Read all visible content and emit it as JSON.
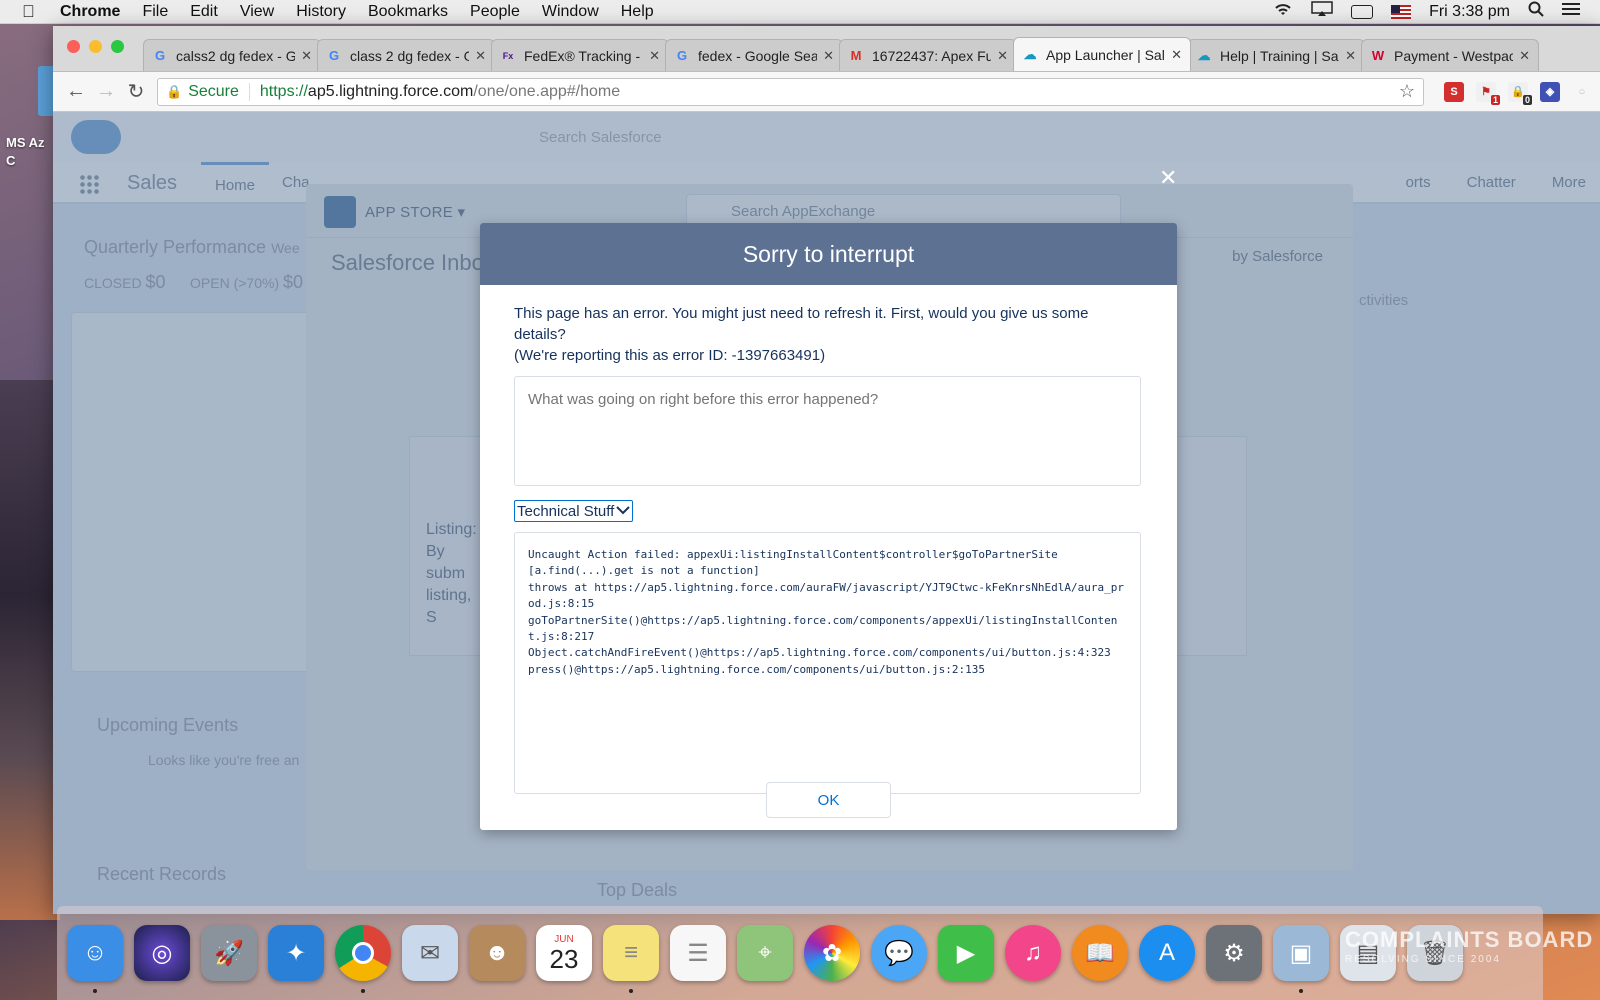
{
  "menubar": {
    "app": "Chrome",
    "items": [
      "File",
      "Edit",
      "View",
      "History",
      "Bookmarks",
      "People",
      "Window",
      "Help"
    ],
    "clock": "Fri 3:38 pm"
  },
  "desktop": {
    "label": "MS Az C"
  },
  "tabs": [
    {
      "title": "calss2 dg fedex - G",
      "icon": "google-icon",
      "active": false
    },
    {
      "title": "class 2 dg fedex - G",
      "icon": "google-icon",
      "active": false
    },
    {
      "title": "FedEx® Tracking - F",
      "icon": "fedex-icon",
      "active": false
    },
    {
      "title": "fedex - Google Sear",
      "icon": "google-icon",
      "active": false
    },
    {
      "title": "16722437: Apex Fu",
      "icon": "gmail-icon",
      "active": false
    },
    {
      "title": "App Launcher | Sal",
      "icon": "salesforce-icon",
      "active": true
    },
    {
      "title": "Help | Training | Sal",
      "icon": "salesforce-icon",
      "active": false
    },
    {
      "title": "Payment - Westpac",
      "icon": "westpac-icon",
      "active": false
    }
  ],
  "address": {
    "secure_label": "Secure",
    "scheme": "https://",
    "host": "ap5.lightning.force.com",
    "path": "/one/one.app#/home"
  },
  "extensions": {
    "badge_1": "1",
    "badge_2": "0"
  },
  "salesforce": {
    "search_placeholder": "Search Salesforce",
    "app_name": "Sales",
    "nav_home": "Home",
    "nav_cha": "Cha",
    "nav_right": [
      "orts",
      "Chatter",
      "More"
    ],
    "quarterly": "Quarterly Performance",
    "quarterly_sub": "Wee",
    "closed": "CLOSED",
    "closed_value": "$0",
    "open": "OPEN (>70%)",
    "open_value": "$0",
    "upcoming": "Upcoming Events",
    "upcoming_sub": "Looks like you're free an",
    "recent": "Recent Records",
    "top_deals": "Top Deals",
    "activities": "ctivities"
  },
  "appstore": {
    "title": "APP STORE",
    "search_placeholder": "Search AppExchange",
    "inbox": "Salesforce Inbo",
    "by": "by Salesforce",
    "listing": "Listing: By subm listing, S"
  },
  "dialog": {
    "title": "Sorry to interrupt",
    "message_line1": "This page has an error. You might just need to refresh it. First, would you give us some details?",
    "message_line2": "(We're reporting this as error ID: -1397663491)",
    "feedback_placeholder": "What was going on right before this error happened?",
    "technical_label": "Technical Stuff",
    "stack_trace": "Uncaught Action failed: appexUi:listingInstallContent$controller$goToPartnerSite\n[a.find(...).get is not a function]\nthrows at https://ap5.lightning.force.com/auraFW/javascript/YJT9Ctwc-kFeKnrsNhEdlA/aura_prod.js:8:15\ngoToPartnerSite()@https://ap5.lightning.force.com/components/appexUi/listingInstallContent.js:8:217\nObject.catchAndFireEvent()@https://ap5.lightning.force.com/components/ui/button.js:4:323\npress()@https://ap5.lightning.force.com/components/ui/button.js:2:135",
    "ok_label": "OK"
  },
  "dock": {
    "apps": [
      {
        "name": "finder",
        "color": "#3a8ee6",
        "running": true
      },
      {
        "name": "siri",
        "color": "#2b2f6b",
        "running": false
      },
      {
        "name": "launchpad",
        "color": "#8a929c",
        "running": false
      },
      {
        "name": "safari",
        "color": "#2a7fd6",
        "running": false
      },
      {
        "name": "chrome",
        "color": "#e8e8e8",
        "running": true
      },
      {
        "name": "mail",
        "color": "#c9d8ea",
        "running": false
      },
      {
        "name": "contacts",
        "color": "#b58a5c",
        "running": false
      },
      {
        "name": "calendar",
        "color": "#ffffff",
        "running": false
      },
      {
        "name": "notes",
        "color": "#f5e27a",
        "running": true
      },
      {
        "name": "reminders",
        "color": "#f7f7f7",
        "running": false
      },
      {
        "name": "maps",
        "color": "#8fc57a",
        "running": false
      },
      {
        "name": "photos",
        "color": "#f4f4f4",
        "running": false
      },
      {
        "name": "messages",
        "color": "#4ba6f5",
        "running": false
      },
      {
        "name": "facetime",
        "color": "#3fbf4a",
        "running": false
      },
      {
        "name": "itunes",
        "color": "#f3468a",
        "running": false
      },
      {
        "name": "ibooks",
        "color": "#f18a1f",
        "running": false
      },
      {
        "name": "app-store",
        "color": "#1b8ef0",
        "running": false
      },
      {
        "name": "system-preferences",
        "color": "#6d7278",
        "running": false
      },
      {
        "name": "preview",
        "color": "#9bb8d6",
        "running": true
      },
      {
        "name": "documents",
        "color": "#dfe4ea",
        "running": false
      },
      {
        "name": "trash",
        "color": "#cfd4da",
        "running": false
      }
    ],
    "calendar_month": "JUN",
    "calendar_day": "23"
  },
  "watermark": {
    "main": "COMPLAINTS BOARD",
    "sub": "RESOLVING SINCE 2004"
  }
}
